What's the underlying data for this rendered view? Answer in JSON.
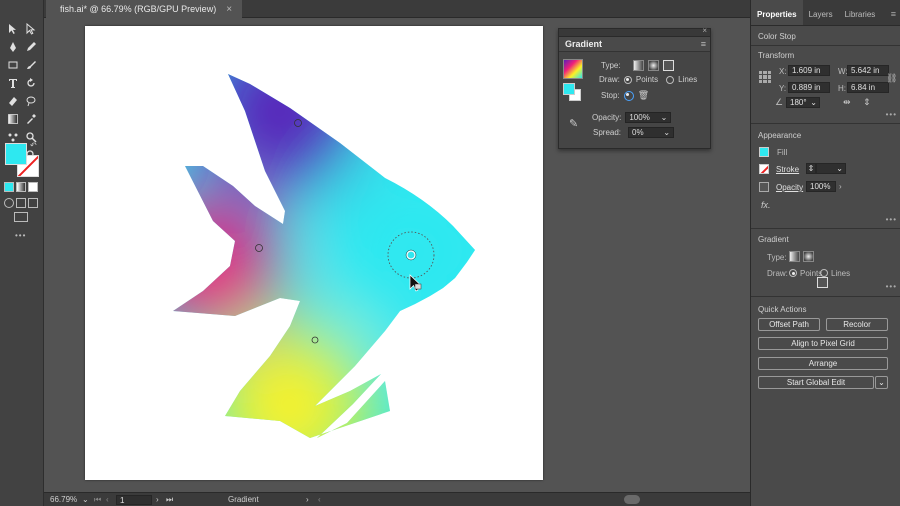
{
  "document": {
    "tab_title": "fish.ai* @ 66.79% (RGB/GPU Preview)",
    "close_glyph": "×"
  },
  "toolbar": {
    "tools": [
      "selection-tool-icon",
      "direct-selection-tool-icon",
      "pen-tool-icon",
      "pencil-tool-icon",
      "rectangle-tool-icon",
      "paintbrush-tool-icon",
      "type-tool-icon",
      "rotate-tool-icon",
      "eraser-tool-icon",
      "lasso-tool-icon",
      "gradient-tool-icon",
      "eyedropper-tool-icon",
      "puppet-warp-tool-icon",
      "hand-tool-icon",
      "artboard-tool-icon",
      "zoom-tool-icon"
    ],
    "more_label": "•••"
  },
  "gradient_panel": {
    "title": "Gradient",
    "type_label": "Type:",
    "draw_label": "Draw:",
    "points_label": "Points",
    "lines_label": "Lines",
    "stop_label": "Stop:",
    "opacity_label": "Opacity:",
    "opacity_value": "100%",
    "spread_label": "Spread:",
    "spread_value": "0%"
  },
  "properties": {
    "tabs": [
      "Properties",
      "Layers",
      "Libraries"
    ],
    "context_label": "Color Stop",
    "transform": {
      "title": "Transform",
      "x_label": "X:",
      "x_value": "1.609 in",
      "y_label": "Y:",
      "y_value": "0.889 in",
      "w_label": "W:",
      "w_value": "5.642 in",
      "h_label": "H:",
      "h_value": "6.84 in",
      "angle_value": "180°"
    },
    "appearance": {
      "title": "Appearance",
      "fill_label": "Fill",
      "stroke_label": "Stroke",
      "opacity_label": "Opacity",
      "opacity_value": "100%",
      "fx_label": "fx."
    },
    "gradient": {
      "title": "Gradient",
      "type_label": "Type:",
      "draw_label": "Draw:",
      "points_label": "Points",
      "lines_label": "Lines"
    },
    "quick_actions": {
      "title": "Quick Actions",
      "offset_path": "Offset Path",
      "recolor": "Recolor",
      "align_pixel": "Align to Pixel Grid",
      "arrange": "Arrange",
      "global_edit": "Start Global Edit"
    },
    "more_label": "•••"
  },
  "statusbar": {
    "zoom": "66.79%",
    "page": "1",
    "tool_name": "Gradient"
  },
  "colors": {
    "cyan": "#2ee8f0",
    "magenta": "#f01f7a",
    "purple": "#5a1fb8",
    "yellow": "#fbf225"
  }
}
